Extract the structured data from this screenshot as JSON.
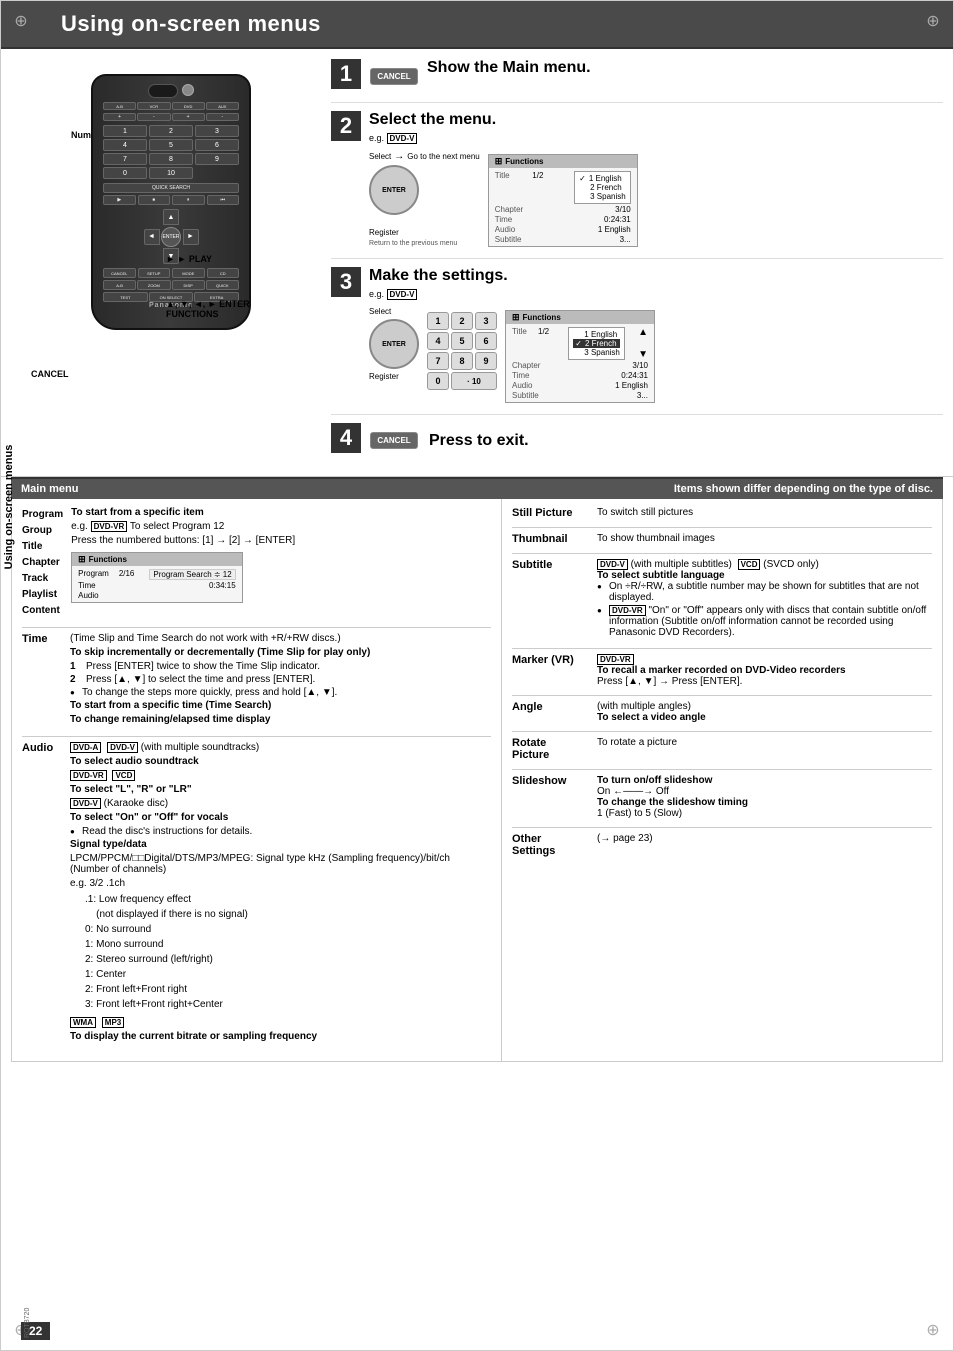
{
  "page": {
    "title": "Using on-screen menus",
    "page_number": "22",
    "rqt_code": "RQT8720",
    "side_label": "Using on-screen menus"
  },
  "steps": [
    {
      "num": "1",
      "title": "Show the Main menu.",
      "description": ""
    },
    {
      "num": "2",
      "title": "Select the menu.",
      "eg": "e.g.",
      "badge": "DVD-V"
    },
    {
      "num": "3",
      "title": "Make the settings.",
      "eg": "e.g.",
      "badge": "DVD-V"
    },
    {
      "num": "4",
      "title": "Press to exit.",
      "description": ""
    }
  ],
  "remote": {
    "brand": "Panasonic",
    "labels": {
      "numbered_buttons": "Numbered buttons",
      "play": "► PLAY",
      "enter_funcs": "▲, ▼, ◄, ► ENTER FUNCTIONS",
      "cancel": "CANCEL"
    }
  },
  "menu_diagram": {
    "select": "Select",
    "go_to_next": "Go to the next menu",
    "register": "Register",
    "return_to_prev": "Return to the previous menu"
  },
  "functions_table_step2": {
    "header": "Functions",
    "rows": [
      {
        "label": "Title",
        "value": "1/2"
      },
      {
        "label": "Chapter",
        "value": "3/10"
      },
      {
        "label": "Time",
        "value": "0:24:31"
      },
      {
        "label": "Audio",
        "value": "1 English"
      },
      {
        "label": "Subtitle",
        "value": "3..."
      }
    ],
    "options": [
      {
        "checked": true,
        "text": "1 English"
      },
      {
        "checked": false,
        "text": "2 French"
      },
      {
        "checked": false,
        "text": "3 Spanish"
      }
    ]
  },
  "functions_table_step3": {
    "header": "Functions",
    "rows": [
      {
        "label": "Title",
        "value": "1/2"
      },
      {
        "label": "Chapter",
        "value": "3/10"
      },
      {
        "label": "Time",
        "value": "0:24:31"
      },
      {
        "label": "Audio",
        "value": "1 English"
      },
      {
        "label": "Subtitle",
        "value": "3..."
      }
    ],
    "options": [
      {
        "checked": false,
        "text": "1 English"
      },
      {
        "checked": true,
        "text": "2 French"
      },
      {
        "checked": false,
        "text": "3 Spanish"
      }
    ]
  },
  "numpad_keys": [
    "1",
    "2",
    "3",
    "4",
    "5",
    "6",
    "7",
    "8",
    "9",
    "0",
    "10"
  ],
  "main_menu": {
    "title": "Main menu",
    "subtitle": "Items shown differ depending on the type of disc."
  },
  "left_menu_items": [
    {
      "heading": "Program",
      "sub_items": [
        "Group",
        "Title",
        "Chapter",
        "Track",
        "Playlist",
        "Content"
      ]
    }
  ],
  "program_content": {
    "heading": "To start from a specific item",
    "eg_text": "e.g.",
    "badge": "DVD-VR",
    "eg_desc": "To select Program 12",
    "instruction": "Press the numbered buttons: [1] → [2] → [ENTER]",
    "table": {
      "header": "Functions",
      "rows": [
        {
          "label": "Program",
          "value": "2/16",
          "extra": "Program Search ≑ 12"
        },
        {
          "label": "Time",
          "value": "0:34:15"
        },
        {
          "label": "Audio",
          "value": ""
        }
      ]
    }
  },
  "time_content": {
    "heading": "Time",
    "note": "(Time Slip and Time Search do not work with +R/+RW discs.)",
    "bold_heading1": "To skip incrementally or decrementally (Time Slip for play only)",
    "steps": [
      "Press [ENTER] twice to show the Time Slip indicator.",
      "Press [▲, ▼] to select the time and press [ENTER]."
    ],
    "tip": "● To change the steps more quickly, press and hold [▲, ▼].",
    "bold_heading2": "To start from a specific time (Time Search)",
    "bold_heading3": "To change remaining/elapsed time display"
  },
  "audio_content": {
    "heading": "Audio",
    "dvd_a_badge": "DVD-A",
    "dvd_v_badge": "DVD-V",
    "with_multiple": "(with multiple soundtracks)",
    "select_audio": "To select audio soundtrack",
    "dvd_vr_badge": "DVD-VR",
    "vcd_badge": "VCD",
    "select_lr": "To select \"L\", \"R\" or \"LR\"",
    "dvd_v_karaoke": "DVD-V (Karaoke disc)",
    "select_onoff": "To select \"On\" or \"Off\" for vocals",
    "bullet_read": "● Read the disc's instructions for details.",
    "signal_heading": "Signal type/data",
    "signal_desc": "LPCM/PPCM/□□Digital/DTS/MP3/MPEG: Signal type kHz (Sampling frequency)/bit/ch (Number of channels)",
    "eg_channels": "e.g. 3/2 .1ch",
    "channel_options": [
      ".1: Low frequency effect",
      "    (not displayed if there is no signal)",
      "0: No surround",
      "1: Mono surround",
      "2: Stereo surround (left/right)",
      "1: Center",
      "2: Front left+Front right",
      "3: Front left+Front right+Center"
    ],
    "wma_badge": "WMA",
    "mp3_badge": "MP3",
    "wma_desc": "To display the current bitrate or sampling frequency"
  },
  "right_menu_items": [
    {
      "heading": "Still Picture",
      "content": "To switch still pictures"
    },
    {
      "heading": "Thumbnail",
      "content": "To show thumbnail images"
    },
    {
      "heading": "Subtitle",
      "badges": [
        "DVD-V",
        "VCD"
      ],
      "with_multiple": "(with multiple subtitles)",
      "svcd_note": "(SVCD only)",
      "desc1": "To select subtitle language",
      "bullet1": "On ÷R/÷RW, a subtitle number may be shown for subtitles that are not displayed.",
      "dvd_vr_note": "● DVD-VR \"On\" or \"Off\" appears only with discs that contain subtitle on/off information (Subtitle on/off information cannot be recorded using Panasonic DVD Recorders)."
    },
    {
      "heading": "Marker (VR)",
      "badges": [
        "DVD-VR"
      ],
      "desc": "To recall a marker recorded on DVD-Video recorders",
      "instruction": "Press [▲, ▼] → Press [ENTER]."
    },
    {
      "heading": "Angle",
      "with_note": "(with multiple angles)",
      "desc": "To select a video angle"
    },
    {
      "heading": "Rotate Picture",
      "desc": "To rotate a picture"
    },
    {
      "heading": "Slideshow",
      "desc1": "To turn on/off slideshow",
      "onoff": "On ←——→ Off",
      "desc2": "To change the slideshow timing",
      "timing": "1 (Fast) to 5 (Slow)"
    },
    {
      "heading": "Other Settings",
      "desc": "(→ page 23)"
    }
  ]
}
